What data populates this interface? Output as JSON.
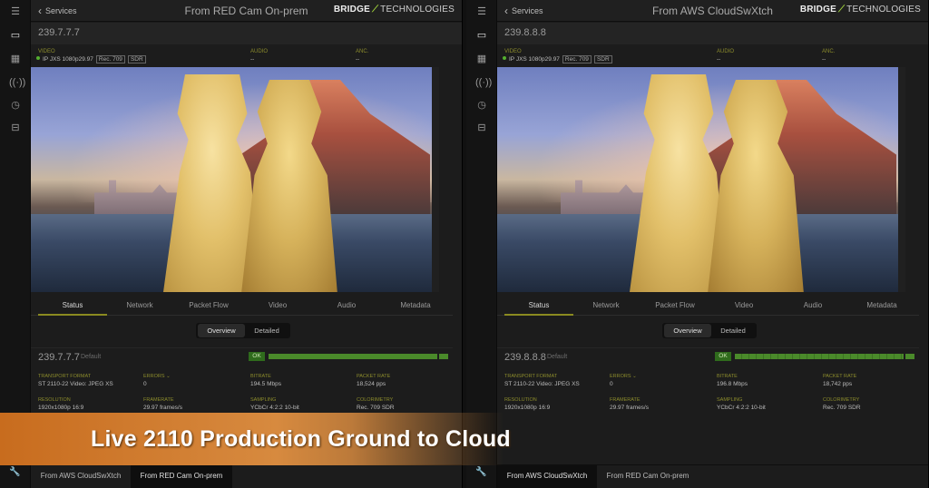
{
  "left": {
    "back_label": "Services",
    "title": "From RED Cam On-prem",
    "brand_bold": "BRIDGE",
    "brand_rest": "TECHNOLOGIES",
    "ip": "239.7.7.7",
    "meta": {
      "video_label": "VIDEO",
      "video_value": "IP JXS 1080p29.97",
      "video_tag1": "Rec. 709",
      "video_tag2": "SDR",
      "audio_label": "AUDIO",
      "audio_value": "--",
      "anc_label": "ANC.",
      "anc_value": "--"
    },
    "tabs": [
      "Status",
      "Network",
      "Packet Flow",
      "Video",
      "Audio",
      "Metadata"
    ],
    "seg": [
      "Overview",
      "Detailed"
    ],
    "stream_ip": "239.7.7.7",
    "stream_default": "Default",
    "ok": "OK",
    "stats": {
      "transport_k": "TRANSPORT FORMAT",
      "transport_v": "ST 2110-22 Video: JPEG XS",
      "errors_k": "ERRORS",
      "errors_v": "0",
      "bitrate_k": "BITRATE",
      "bitrate_v": "194.5 Mbps",
      "packet_k": "PACKET RATE",
      "packet_v": "18,524 pps",
      "res_k": "RESOLUTION",
      "res_v": "1920x1080p  16:9",
      "frame_k": "FRAMERATE",
      "frame_v": "29.97 frames/s",
      "samp_k": "SAMPLING",
      "samp_v": "YCbCr 4:2:2 10-bit",
      "color_k": "COLORIMETRY",
      "color_v": "Rec. 709  SDR"
    },
    "bottom": [
      "From AWS CloudSwXtch",
      "From RED Cam On-prem"
    ]
  },
  "right": {
    "back_label": "Services",
    "title": "From AWS CloudSwXtch",
    "brand_bold": "BRIDGE",
    "brand_rest": "TECHNOLOGIES",
    "ip": "239.8.8.8",
    "meta": {
      "video_label": "VIDEO",
      "video_value": "IP JXS 1080p29.97",
      "video_tag1": "Rec. 709",
      "video_tag2": "SDR",
      "audio_label": "AUDIO",
      "audio_value": "--",
      "anc_label": "ANC.",
      "anc_value": "--"
    },
    "tabs": [
      "Status",
      "Network",
      "Packet Flow",
      "Video",
      "Audio",
      "Metadata"
    ],
    "seg": [
      "Overview",
      "Detailed"
    ],
    "stream_ip": "239.8.8.8",
    "stream_default": "Default",
    "ok": "OK",
    "stats": {
      "transport_k": "TRANSPORT FORMAT",
      "transport_v": "ST 2110-22 Video: JPEG XS",
      "errors_k": "ERRORS",
      "errors_v": "0",
      "bitrate_k": "BITRATE",
      "bitrate_v": "196.8 Mbps",
      "packet_k": "PACKET RATE",
      "packet_v": "18,742 pps",
      "res_k": "RESOLUTION",
      "res_v": "1920x1080p  16:9",
      "frame_k": "FRAMERATE",
      "frame_v": "29.97 frames/s",
      "samp_k": "SAMPLING",
      "samp_v": "YCbCr 4:2:2 10-bit",
      "color_k": "COLORIMETRY",
      "color_v": "Rec. 709  SDR"
    },
    "bottom": [
      "From AWS CloudSwXtch",
      "From RED Cam On-prem"
    ]
  },
  "banner": {
    "text": "Live 2110 Production Ground to Cloud"
  },
  "icons": [
    "hamburger-menu-icon",
    "monitor-icon",
    "dashboard-icon",
    "broadcast-icon",
    "clock-icon",
    "toolbox-icon",
    "wrench-icon",
    "chevron-left-icon",
    "chevron-down-icon"
  ],
  "colors": {
    "accent": "#8a8a20",
    "ok_green": "#4a8a2a",
    "banner": "#c86c1e"
  }
}
